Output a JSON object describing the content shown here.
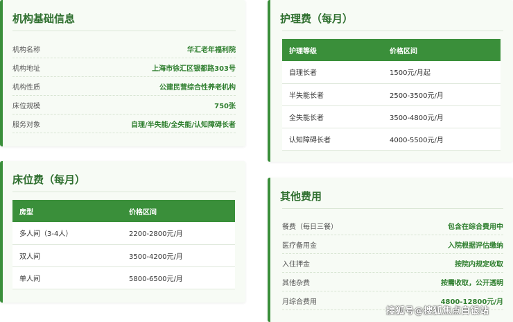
{
  "institution": {
    "title": "机构基础信息",
    "rows": [
      {
        "label": "机构名称",
        "value": "华汇老年福利院"
      },
      {
        "label": "机构地址",
        "value": "上海市徐汇区银都路303号"
      },
      {
        "label": "机构性质",
        "value": "公建民营综合性养老机构"
      },
      {
        "label": "床位规模",
        "value": "750张"
      },
      {
        "label": "服务对象",
        "value": "自理/半失能/全失能/认知障碍长者"
      }
    ]
  },
  "nursing_fee": {
    "title": "护理费（每月）",
    "headers": [
      "护理等级",
      "价格区间"
    ],
    "rows": [
      [
        "自理长者",
        "1500元/月起"
      ],
      [
        "半失能长者",
        "2500-3500元/月"
      ],
      [
        "全失能长者",
        "3500-4800元/月"
      ],
      [
        "认知障碍长者",
        "4000-5500元/月"
      ]
    ]
  },
  "bed_fee": {
    "title": "床位费（每月）",
    "headers": [
      "房型",
      "价格区间"
    ],
    "rows": [
      [
        "多人间（3-4人）",
        "2200-2800元/月"
      ],
      [
        "双人间",
        "3500-4200元/月"
      ],
      [
        "单人间",
        "5800-6500元/月"
      ]
    ]
  },
  "other_fees": {
    "title": "其他费用",
    "rows": [
      {
        "label": "餐费（每日三餐）",
        "value": "包含在综合费用中"
      },
      {
        "label": "医疗备用金",
        "value": "入院根据评估缴纳"
      },
      {
        "label": "入住押金",
        "value": "按院内规定收取"
      },
      {
        "label": "其他杂费",
        "value": "按需收取，公开透明"
      },
      {
        "label": "月综合费用",
        "value": "4800-12800元/月"
      }
    ]
  },
  "watermark": "搜狐号@搜狐焦点白银站",
  "colors": {
    "accent": "#3a8f3a",
    "card_bg": "#f7fbf5",
    "title": "#2f6f2f"
  }
}
